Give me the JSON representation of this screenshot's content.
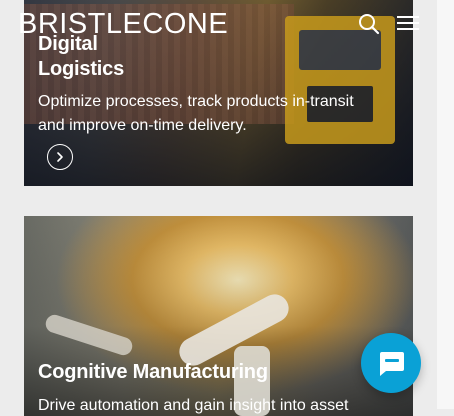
{
  "header": {
    "logo_text": "BRISTLECONE",
    "search_icon": "search-icon",
    "menu_icon": "hamburger-menu-icon"
  },
  "cards": [
    {
      "title_line1": "Digital",
      "title_line2": "Logistics",
      "description_line1": "Optimize processes, track products in-transit",
      "description_line2": "and improve on-time delivery.",
      "action_icon": "chevron-right-icon"
    },
    {
      "title": "Cognitive Manufacturing",
      "description_line1": "Drive automation and gain insight into asset"
    }
  ],
  "chat_widget": {
    "icon": "chat-bubble-icon",
    "color": "#0aa1d6"
  }
}
